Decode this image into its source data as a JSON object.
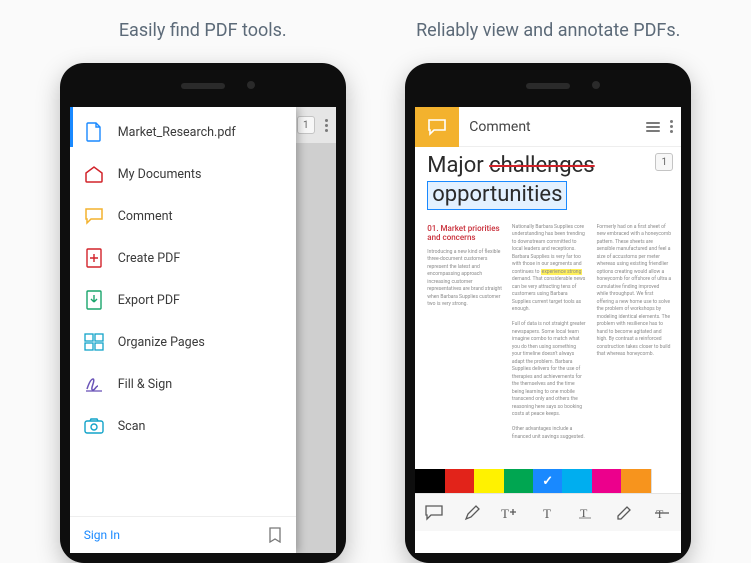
{
  "headlines": {
    "left": "Easily find PDF tools.",
    "right": "Reliably view and annotate PDFs."
  },
  "left_screen": {
    "badge": "1",
    "drawer": {
      "items": [
        {
          "icon": "file-icon",
          "label": "Market_Research.pdf",
          "color": "#1989ff"
        },
        {
          "icon": "home-icon",
          "label": "My Documents",
          "color": "#d2232a"
        },
        {
          "icon": "comment-icon",
          "label": "Comment",
          "color": "#f3b22e"
        },
        {
          "icon": "create-pdf-icon",
          "label": "Create PDF",
          "color": "#d2232a"
        },
        {
          "icon": "export-pdf-icon",
          "label": "Export PDF",
          "color": "#1aa56c"
        },
        {
          "icon": "organize-icon",
          "label": "Organize Pages",
          "color": "#12a3c9"
        },
        {
          "icon": "fill-sign-icon",
          "label": "Fill & Sign",
          "color": "#6b55b8"
        },
        {
          "icon": "scan-icon",
          "label": "Scan",
          "color": "#12a3c9"
        }
      ],
      "sign_in": "Sign In"
    }
  },
  "right_screen": {
    "title": "Comment",
    "badge": "1",
    "document": {
      "line1_plain": "Major ",
      "line1_struck": "challenges",
      "line2_boxed": "opportunities",
      "section_heading": "01. Market priorities and concerns"
    },
    "palette": [
      {
        "hex": "#000000",
        "selected": false
      },
      {
        "hex": "#e2231a",
        "selected": false
      },
      {
        "hex": "#fff200",
        "selected": false
      },
      {
        "hex": "#00a651",
        "selected": false
      },
      {
        "hex": "#1989ff",
        "selected": true
      },
      {
        "hex": "#00aeef",
        "selected": false
      },
      {
        "hex": "#ec008c",
        "selected": false
      },
      {
        "hex": "#f7941d",
        "selected": false
      },
      {
        "hex": "#ffffff",
        "selected": false
      }
    ],
    "tools": [
      "comment-bubble-icon",
      "pencil-icon",
      "text-add-icon",
      "text-icon",
      "highlight-icon",
      "draw-icon",
      "strike-icon"
    ]
  }
}
